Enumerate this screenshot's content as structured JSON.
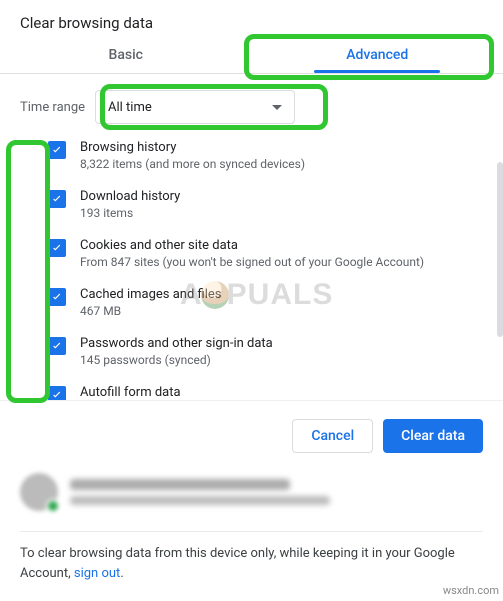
{
  "title": "Clear browsing data",
  "tabs": {
    "basic": "Basic",
    "advanced": "Advanced",
    "active": "advanced"
  },
  "time": {
    "label": "Time range",
    "value": "All time"
  },
  "items": [
    {
      "title": "Browsing history",
      "sub": "8,322 items (and more on synced devices)",
      "checked": true
    },
    {
      "title": "Download history",
      "sub": "193 items",
      "checked": true
    },
    {
      "title": "Cookies and other site data",
      "sub": "From 847 sites (you won't be signed out of your Google Account)",
      "checked": true
    },
    {
      "title": "Cached images and files",
      "sub": "467 MB",
      "checked": true
    },
    {
      "title": "Passwords and other sign-in data",
      "sub": "145 passwords (synced)",
      "checked": true
    },
    {
      "title": "Autofill form data",
      "sub": "",
      "checked": true
    }
  ],
  "actions": {
    "cancel": "Cancel",
    "clear": "Clear data"
  },
  "footer": {
    "text_before": "To clear browsing data from this device only, while keeping it in your Google Account, ",
    "link": "sign out",
    "text_after": "."
  },
  "watermarks": {
    "site": "wsxdn.com",
    "brand_left": "A",
    "brand_right": "PUALS"
  }
}
